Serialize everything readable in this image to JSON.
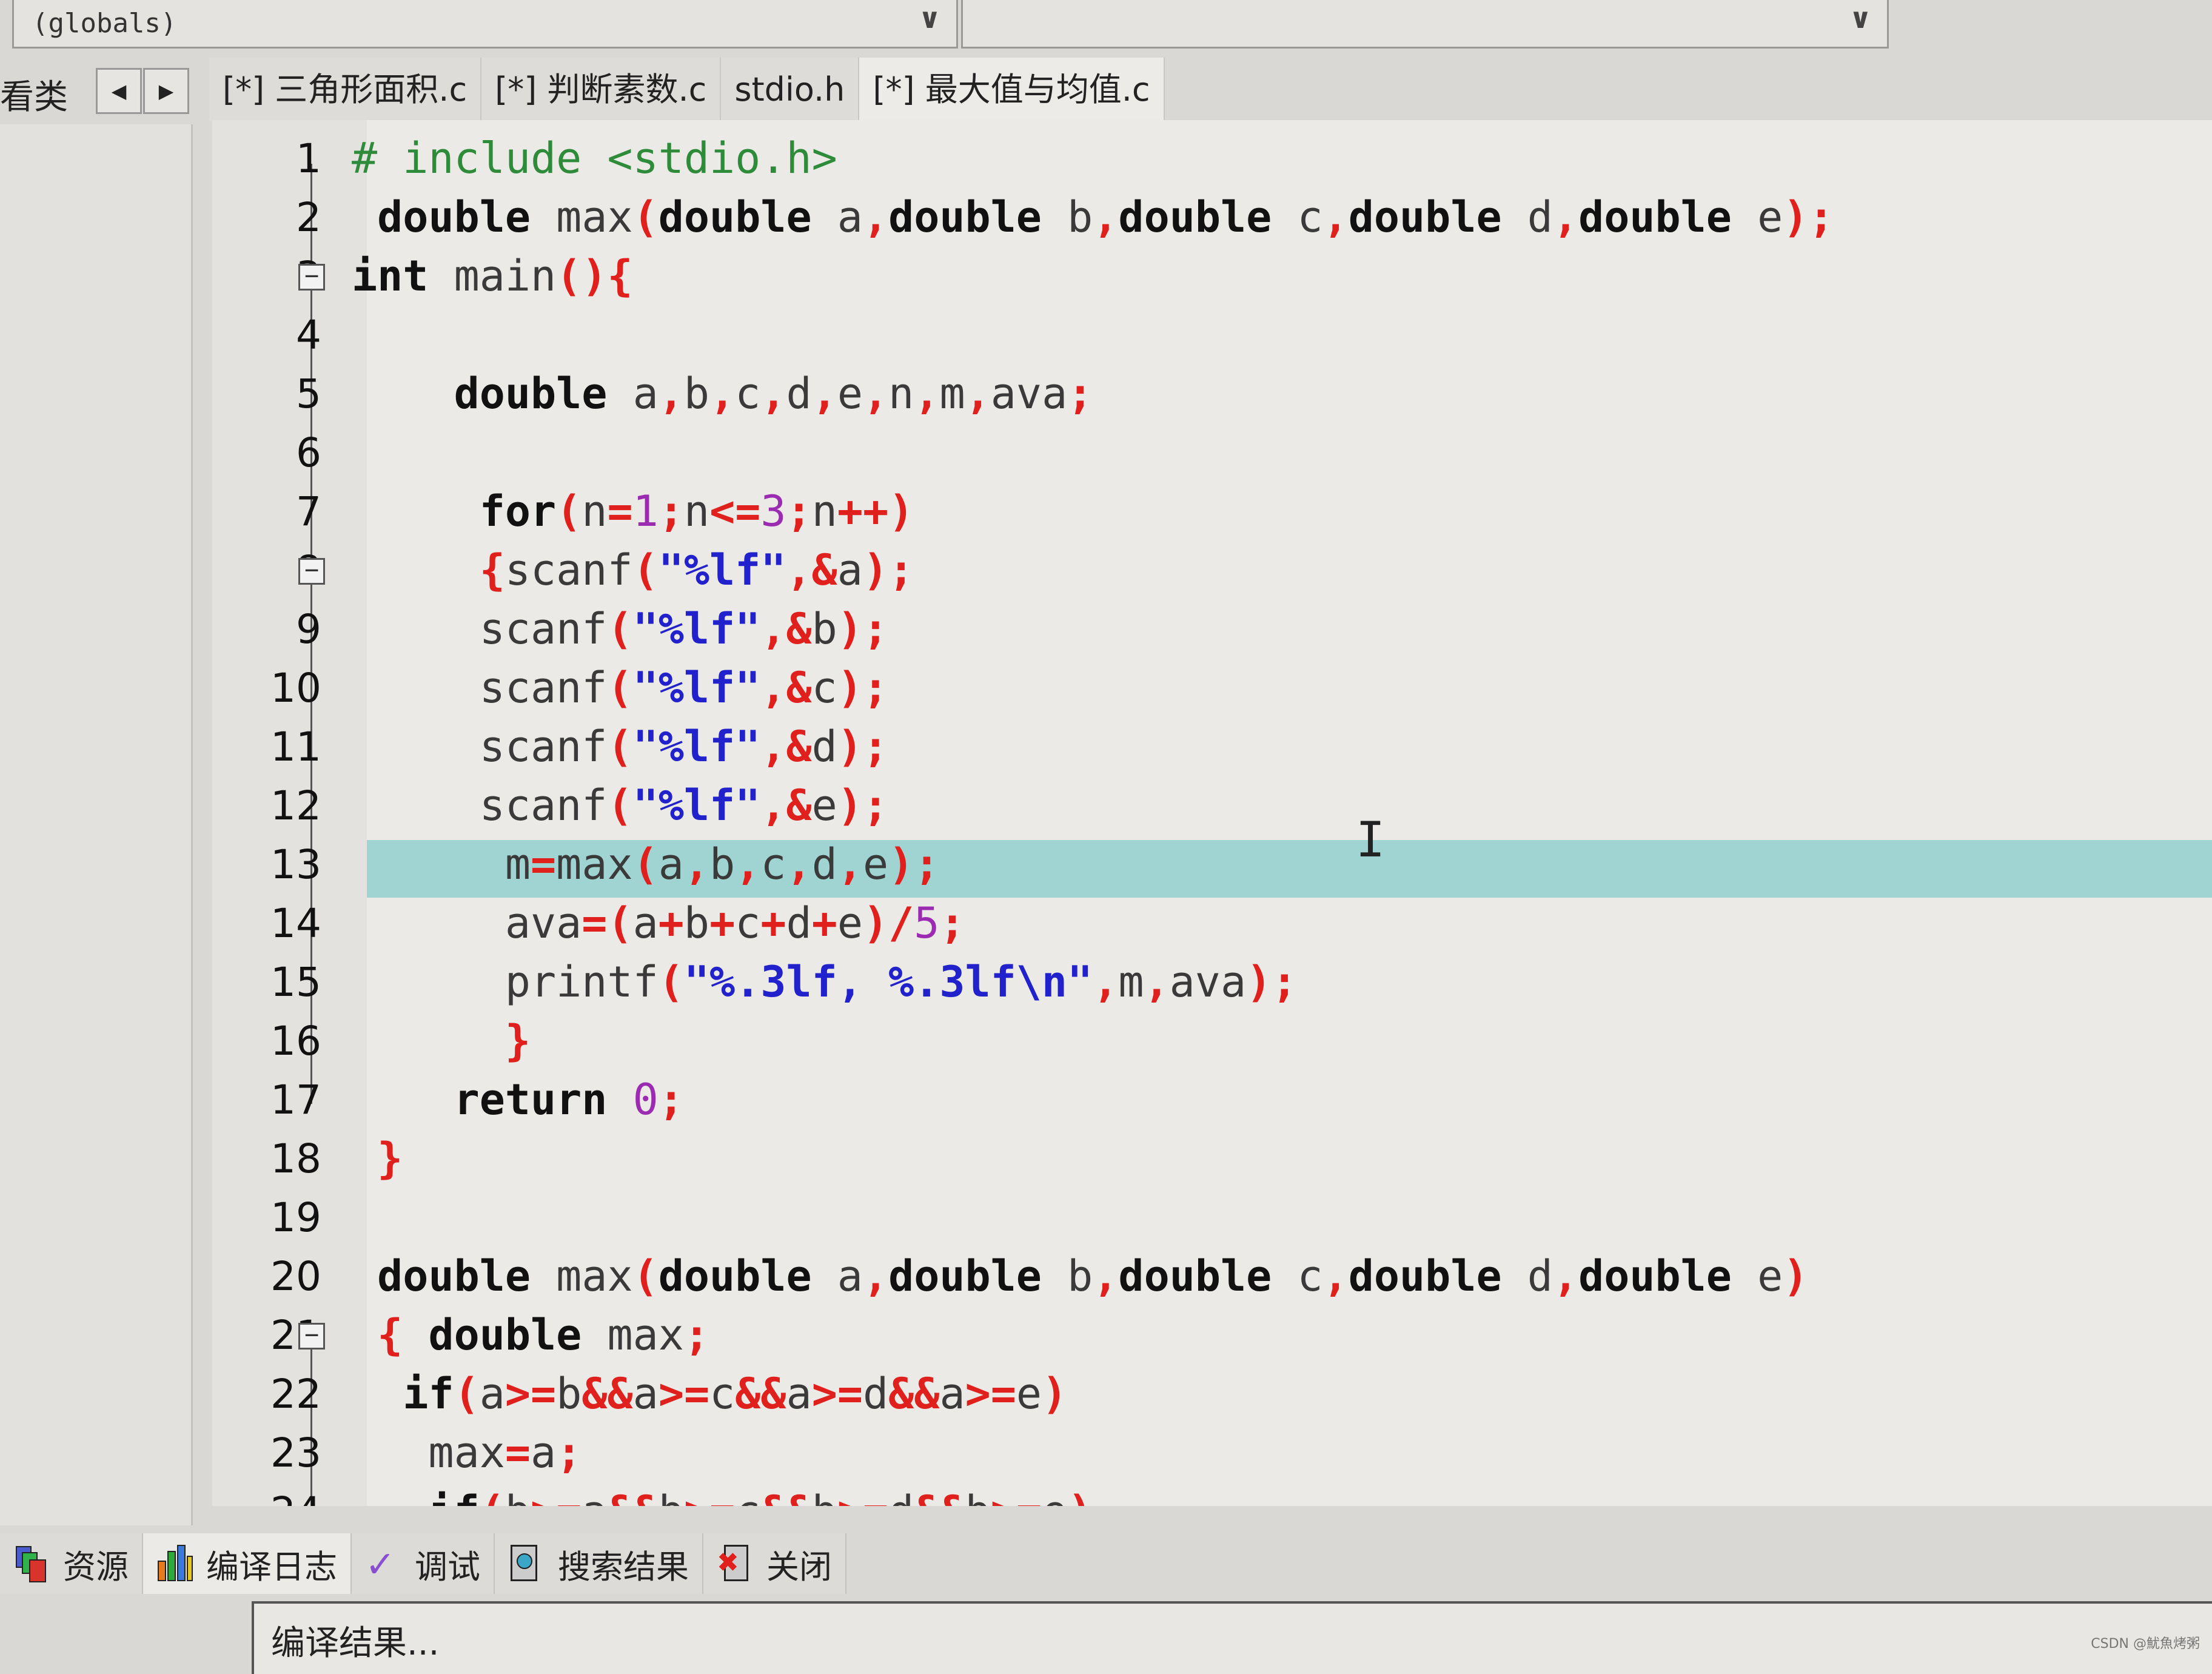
{
  "scope_combo": {
    "value": "(globals)"
  },
  "class_combo": {
    "value": ""
  },
  "left_panel_tab": "看类",
  "tabs": [
    {
      "label": "[*] 三角形面积.c"
    },
    {
      "label": "[*] 判断素数.c"
    },
    {
      "label": "stdio.h"
    },
    {
      "label": "[*] 最大值与均值.c",
      "active": true
    }
  ],
  "highlighted_line": 13,
  "fold_markers": [
    3,
    8,
    21
  ],
  "lines": [
    [
      [
        "pre",
        "# include <stdio.h>"
      ]
    ],
    [
      [
        "id",
        " "
      ],
      [
        "kw",
        "double"
      ],
      [
        "id",
        " max"
      ],
      [
        "op",
        "("
      ],
      [
        "kw",
        "double"
      ],
      [
        "id",
        " a"
      ],
      [
        "op",
        ","
      ],
      [
        "kw",
        "double"
      ],
      [
        "id",
        " b"
      ],
      [
        "op",
        ","
      ],
      [
        "kw",
        "double"
      ],
      [
        "id",
        " c"
      ],
      [
        "op",
        ","
      ],
      [
        "kw",
        "double"
      ],
      [
        "id",
        " d"
      ],
      [
        "op",
        ","
      ],
      [
        "kw",
        "double"
      ],
      [
        "id",
        " e"
      ],
      [
        "op",
        ");"
      ]
    ],
    [
      [
        "kw",
        "int"
      ],
      [
        "id",
        " main"
      ],
      [
        "op",
        "(){"
      ]
    ],
    [],
    [
      [
        "id",
        "    "
      ],
      [
        "kw",
        "double"
      ],
      [
        "id",
        " a"
      ],
      [
        "op",
        ","
      ],
      [
        "id",
        "b"
      ],
      [
        "op",
        ","
      ],
      [
        "id",
        "c"
      ],
      [
        "op",
        ","
      ],
      [
        "id",
        "d"
      ],
      [
        "op",
        ","
      ],
      [
        "id",
        "e"
      ],
      [
        "op",
        ","
      ],
      [
        "id",
        "n"
      ],
      [
        "op",
        ","
      ],
      [
        "id",
        "m"
      ],
      [
        "op",
        ","
      ],
      [
        "id",
        "ava"
      ],
      [
        "op",
        ";"
      ]
    ],
    [],
    [
      [
        "id",
        "     "
      ],
      [
        "kw",
        "for"
      ],
      [
        "op",
        "("
      ],
      [
        "id",
        "n"
      ],
      [
        "op",
        "="
      ],
      [
        "num",
        "1"
      ],
      [
        "op",
        ";"
      ],
      [
        "id",
        "n"
      ],
      [
        "op",
        "<="
      ],
      [
        "num",
        "3"
      ],
      [
        "op",
        ";"
      ],
      [
        "id",
        "n"
      ],
      [
        "op",
        "++)"
      ]
    ],
    [
      [
        "id",
        "     "
      ],
      [
        "op",
        "{"
      ],
      [
        "id",
        "scanf"
      ],
      [
        "op",
        "("
      ],
      [
        "str",
        "\"%lf\""
      ],
      [
        "op",
        ",&"
      ],
      [
        "id",
        "a"
      ],
      [
        "op",
        ");"
      ]
    ],
    [
      [
        "id",
        "     scanf"
      ],
      [
        "op",
        "("
      ],
      [
        "str",
        "\"%lf\""
      ],
      [
        "op",
        ",&"
      ],
      [
        "id",
        "b"
      ],
      [
        "op",
        ");"
      ]
    ],
    [
      [
        "id",
        "     scanf"
      ],
      [
        "op",
        "("
      ],
      [
        "str",
        "\"%lf\""
      ],
      [
        "op",
        ",&"
      ],
      [
        "id",
        "c"
      ],
      [
        "op",
        ");"
      ]
    ],
    [
      [
        "id",
        "     scanf"
      ],
      [
        "op",
        "("
      ],
      [
        "str",
        "\"%lf\""
      ],
      [
        "op",
        ",&"
      ],
      [
        "id",
        "d"
      ],
      [
        "op",
        ");"
      ]
    ],
    [
      [
        "id",
        "     scanf"
      ],
      [
        "op",
        "("
      ],
      [
        "str",
        "\"%lf\""
      ],
      [
        "op",
        ",&"
      ],
      [
        "id",
        "e"
      ],
      [
        "op",
        ");"
      ]
    ],
    [
      [
        "id",
        "      m"
      ],
      [
        "op",
        "="
      ],
      [
        "id",
        "max"
      ],
      [
        "op",
        "("
      ],
      [
        "id",
        "a"
      ],
      [
        "op",
        ","
      ],
      [
        "id",
        "b"
      ],
      [
        "op",
        ","
      ],
      [
        "id",
        "c"
      ],
      [
        "op",
        ","
      ],
      [
        "id",
        "d"
      ],
      [
        "op",
        ","
      ],
      [
        "id",
        "e"
      ],
      [
        "op",
        ");"
      ]
    ],
    [
      [
        "id",
        "      ava"
      ],
      [
        "op",
        "=("
      ],
      [
        "id",
        "a"
      ],
      [
        "op",
        "+"
      ],
      [
        "id",
        "b"
      ],
      [
        "op",
        "+"
      ],
      [
        "id",
        "c"
      ],
      [
        "op",
        "+"
      ],
      [
        "id",
        "d"
      ],
      [
        "op",
        "+"
      ],
      [
        "id",
        "e"
      ],
      [
        "op",
        ")/"
      ],
      [
        "num",
        "5"
      ],
      [
        "op",
        ";"
      ]
    ],
    [
      [
        "id",
        "      printf"
      ],
      [
        "op",
        "("
      ],
      [
        "str",
        "\"%.3lf, %.3lf\\n\""
      ],
      [
        "op",
        ","
      ],
      [
        "id",
        "m"
      ],
      [
        "op",
        ","
      ],
      [
        "id",
        "ava"
      ],
      [
        "op",
        ");"
      ]
    ],
    [
      [
        "id",
        "      "
      ],
      [
        "op",
        "}"
      ]
    ],
    [
      [
        "id",
        "    "
      ],
      [
        "kw",
        "return"
      ],
      [
        "id",
        " "
      ],
      [
        "num",
        "0"
      ],
      [
        "op",
        ";"
      ]
    ],
    [
      [
        "id",
        " "
      ],
      [
        "op",
        "}"
      ]
    ],
    [],
    [
      [
        "id",
        " "
      ],
      [
        "kw",
        "double"
      ],
      [
        "id",
        " max"
      ],
      [
        "op",
        "("
      ],
      [
        "kw",
        "double"
      ],
      [
        "id",
        " a"
      ],
      [
        "op",
        ","
      ],
      [
        "kw",
        "double"
      ],
      [
        "id",
        " b"
      ],
      [
        "op",
        ","
      ],
      [
        "kw",
        "double"
      ],
      [
        "id",
        " c"
      ],
      [
        "op",
        ","
      ],
      [
        "kw",
        "double"
      ],
      [
        "id",
        " d"
      ],
      [
        "op",
        ","
      ],
      [
        "kw",
        "double"
      ],
      [
        "id",
        " e"
      ],
      [
        "op",
        ")"
      ]
    ],
    [
      [
        "id",
        " "
      ],
      [
        "op",
        "{"
      ],
      [
        "id",
        " "
      ],
      [
        "kw",
        "double"
      ],
      [
        "id",
        " max"
      ],
      [
        "op",
        ";"
      ]
    ],
    [
      [
        "id",
        "  "
      ],
      [
        "kw",
        "if"
      ],
      [
        "op",
        "("
      ],
      [
        "id",
        "a"
      ],
      [
        "op",
        ">="
      ],
      [
        "id",
        "b"
      ],
      [
        "op",
        "&&"
      ],
      [
        "id",
        "a"
      ],
      [
        "op",
        ">="
      ],
      [
        "id",
        "c"
      ],
      [
        "op",
        "&&"
      ],
      [
        "id",
        "a"
      ],
      [
        "op",
        ">="
      ],
      [
        "id",
        "d"
      ],
      [
        "op",
        "&&"
      ],
      [
        "id",
        "a"
      ],
      [
        "op",
        ">="
      ],
      [
        "id",
        "e"
      ],
      [
        "op",
        ")"
      ]
    ],
    [
      [
        "id",
        "   max"
      ],
      [
        "op",
        "="
      ],
      [
        "id",
        "a"
      ],
      [
        "op",
        ";"
      ]
    ],
    [
      [
        "id",
        "   "
      ],
      [
        "kw",
        "if"
      ],
      [
        "op",
        "("
      ],
      [
        "id",
        "b"
      ],
      [
        "op",
        ">="
      ],
      [
        "id",
        "a"
      ],
      [
        "op",
        "&&"
      ],
      [
        "id",
        "b"
      ],
      [
        "op",
        ">="
      ],
      [
        "id",
        "c"
      ],
      [
        "op",
        "&&"
      ],
      [
        "id",
        "b"
      ],
      [
        "op",
        ">="
      ],
      [
        "id",
        "d"
      ],
      [
        "op",
        "&&"
      ],
      [
        "id",
        "b"
      ],
      [
        "op",
        ">="
      ],
      [
        "id",
        "e"
      ],
      [
        "op",
        ")"
      ]
    ]
  ],
  "bottom_tabs": [
    {
      "label": "资源",
      "icon": "resources-icon"
    },
    {
      "label": "编译日志",
      "icon": "compile-log-icon",
      "active": true
    },
    {
      "label": "调试",
      "icon": "debug-check-icon"
    },
    {
      "label": "搜索结果",
      "icon": "search-results-icon"
    },
    {
      "label": "关闭",
      "icon": "close-icon"
    }
  ],
  "output_text": "编译结果...",
  "watermark": "CSDN @魷魚烤粥"
}
